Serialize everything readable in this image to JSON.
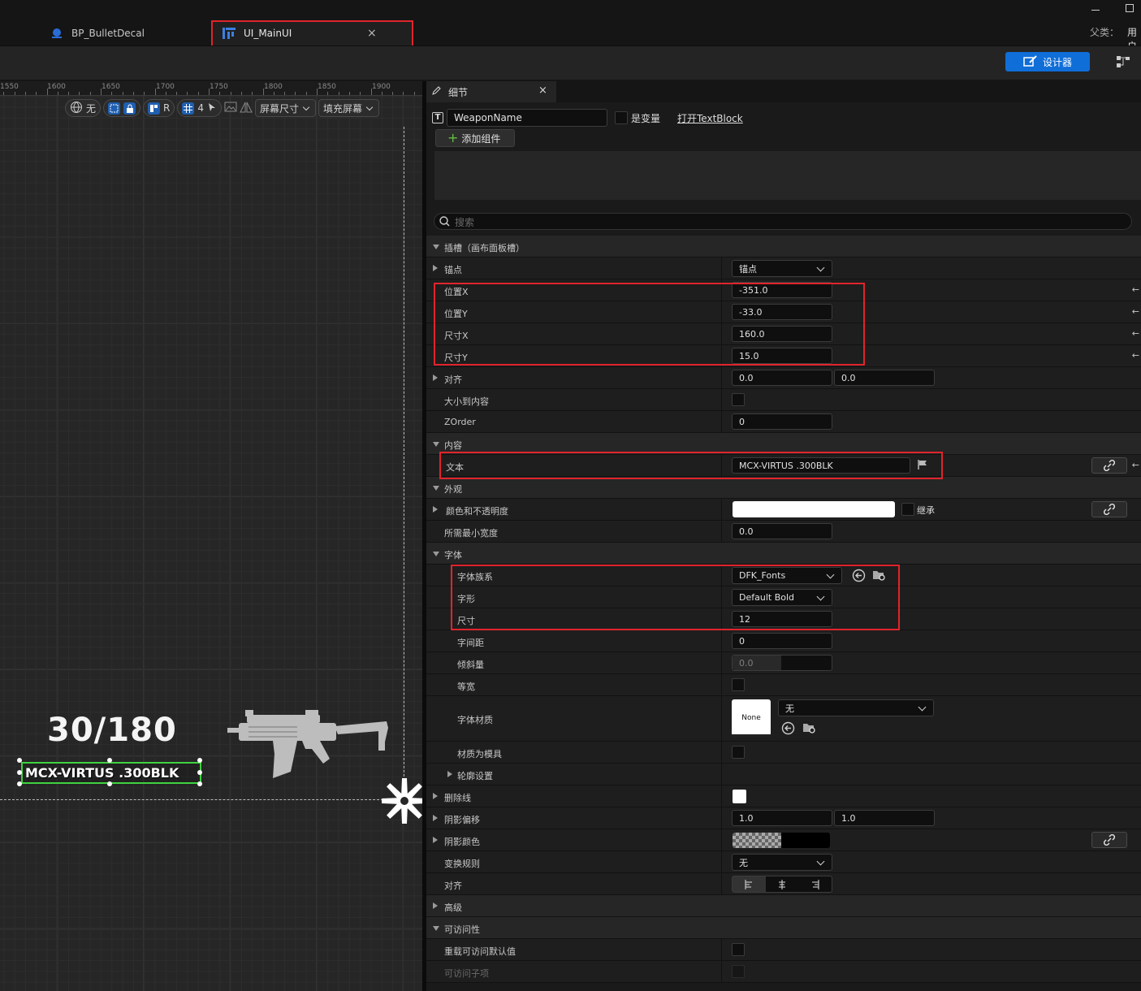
{
  "window": {
    "tabs": [
      {
        "label": "BP_BulletDecal",
        "icon": "blueprint-icon"
      },
      {
        "label": "UI_MainUI",
        "icon": "widget-blueprint-icon"
      }
    ],
    "close_glyph": "×",
    "parent_class_label": "父类：",
    "parent_class_value": "用户",
    "designer_label": "设计器"
  },
  "viewport": {
    "ruler_labels": [
      "1550",
      "1600",
      "1650",
      "1700",
      "1750",
      "1800",
      "1850",
      "1900"
    ],
    "tools": {
      "world_label": "无",
      "r_label": "R",
      "grid_label": "4",
      "screen_size_label": "屏幕尺寸",
      "fill_screen_label": "填充屏幕"
    },
    "ammo_text": "30/180",
    "weapon_text": "MCX-VIRTUS .300BLK"
  },
  "details": {
    "tab_label": "细节",
    "widget_name": "WeaponName",
    "is_variable_label": "是变量",
    "open_link_label": "打开TextBlock",
    "add_component_label": "添加组件",
    "search_placeholder": "搜索",
    "sections": {
      "slot": "插槽（画布面板槽）",
      "content": "内容",
      "appearance": "外观",
      "font": "字体",
      "advanced": "高级",
      "accessibility": "可访问性"
    },
    "props": {
      "anchor_label": "锚点",
      "anchor_value": "锚点",
      "pos_x_label": "位置X",
      "pos_x_value": "-351.0",
      "pos_y_label": "位置Y",
      "pos_y_value": "-33.0",
      "size_x_label": "尺寸X",
      "size_x_value": "160.0",
      "size_y_label": "尺寸Y",
      "size_y_value": "15.0",
      "align_label": "对齐",
      "align_x": "0.0",
      "align_y": "0.0",
      "auto_size_label": "大小到内容",
      "zorder_label": "ZOrder",
      "zorder_value": "0",
      "text_label": "文本",
      "text_value": "MCX-VIRTUS .300BLK",
      "color_label": "颜色和不透明度",
      "inherit_label": "继承",
      "min_width_label": "所需最小宽度",
      "min_width_value": "0.0",
      "font_family_label": "字体族系",
      "font_family_value": "DFK_Fonts",
      "typeface_label": "字形",
      "typeface_value": "Default Bold",
      "font_size_label": "尺寸",
      "font_size_value": "12",
      "letter_spacing_label": "字间距",
      "letter_spacing_value": "0",
      "skew_label": "倾斜量",
      "skew_value": "0.0",
      "monospace_label": "等宽",
      "font_material_label": "字体材质",
      "font_material_thumb": "None",
      "font_material_value": "无",
      "material_mask_label": "材质为模具",
      "outline_label": "轮廓设置",
      "strike_label": "删除线",
      "shadow_offset_label": "阴影偏移",
      "shadow_offset_x": "1.0",
      "shadow_offset_y": "1.0",
      "shadow_color_label": "阴影颜色",
      "transform_label": "变换规则",
      "transform_value": "无",
      "justify_label": "对齐",
      "override_access_label": "重载可访问默认值",
      "access_children_label": "可访问子项"
    }
  },
  "colors": {
    "accent_blue": "#0f6ed8",
    "highlight_red": "#e0242c",
    "selection_green": "#3fd23f"
  }
}
